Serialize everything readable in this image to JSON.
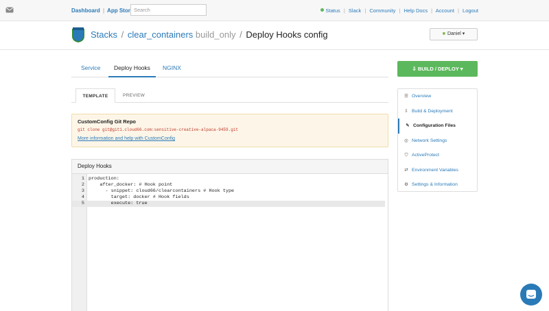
{
  "topbar": {
    "mail_icon": "mail-icon",
    "dashboard": "Dashboard",
    "separator": "|",
    "app_store": "App Store",
    "search_placeholder": "Search",
    "status": "Status",
    "slack": "Slack",
    "community": "Community",
    "help_docs": "Help Docs",
    "account": "Account",
    "logout": "Logout",
    "status_color": "#5cb85c"
  },
  "header": {
    "logo_icon": "cloud66-logo",
    "stacks": "Stacks",
    "slash": "/",
    "stack_name": "clear_containers",
    "env": "build_only",
    "page": "Deploy Hooks config",
    "user": "Daniel"
  },
  "tabs": [
    "Service",
    "Deploy Hooks",
    "NGINX"
  ],
  "active_tab": "Deploy Hooks",
  "deploy_button": "BUILD / DEPLOY",
  "subtabs": [
    "TEMPLATE",
    "PREVIEW"
  ],
  "info": {
    "title": "CustomConfig Git Repo",
    "clone": "git clone git@git1.cloud66.com:sensitive-creative-alpaca-9459.git",
    "help_link": "More information and help with CustomConfig"
  },
  "editor": {
    "title": "Deploy Hooks",
    "lines": [
      {
        "n": "1",
        "text": "production:"
      },
      {
        "n": "2",
        "text": "    after_docker: # Hook point"
      },
      {
        "n": "3",
        "text": "      - snippet: cloud66/clearcontainers # Hook type"
      },
      {
        "n": "4",
        "text": "        target: docker # Hook fields"
      },
      {
        "n": "5",
        "text": "        execute: true"
      }
    ]
  },
  "sidebar": {
    "items": [
      {
        "label": "Overview",
        "icon": "list-icon"
      },
      {
        "label": "Build & Deployment",
        "icon": "deploy-icon"
      },
      {
        "label": "Configuration Files",
        "icon": "wrench-icon"
      },
      {
        "label": "Network Settings",
        "icon": "network-icon"
      },
      {
        "label": "ActiveProtect",
        "icon": "shield-icon"
      },
      {
        "label": "Environment Variables",
        "icon": "arrows-icon"
      },
      {
        "label": "Settings & Information",
        "icon": "gear-icon"
      }
    ],
    "active": "Configuration Files",
    "accent": "#2a7ab8"
  },
  "chat_icon": "chat-icon"
}
